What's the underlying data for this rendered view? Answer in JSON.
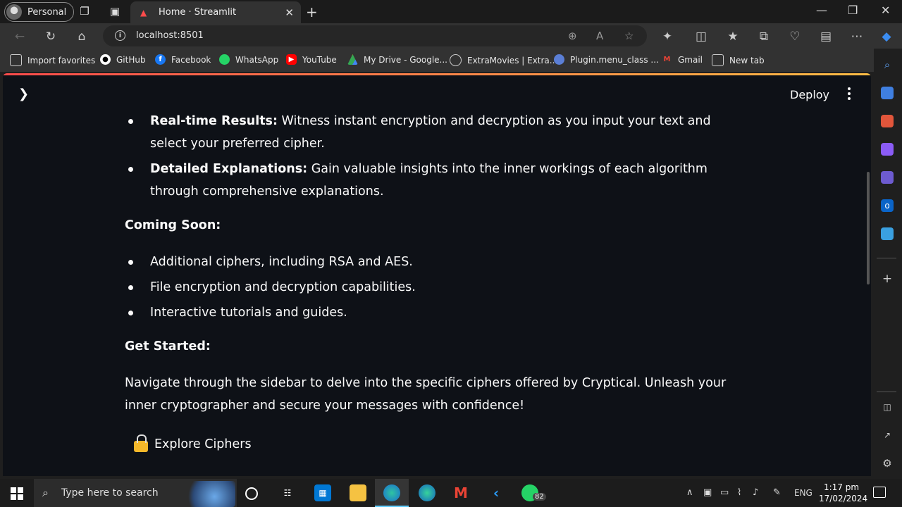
{
  "browser": {
    "profile_label": "Personal",
    "tab_title": "Home · Streamlit",
    "url": "localhost:8501",
    "bookmarks": [
      {
        "label": "Import favorites",
        "icon": "import-icon"
      },
      {
        "label": "GitHub",
        "icon": "github-icon"
      },
      {
        "label": "Facebook",
        "icon": "facebook-icon"
      },
      {
        "label": "WhatsApp",
        "icon": "whatsapp-icon"
      },
      {
        "label": "YouTube",
        "icon": "youtube-icon"
      },
      {
        "label": "My Drive - Google...",
        "icon": "google-drive-icon"
      },
      {
        "label": "ExtraMovies | Extra...",
        "icon": "movie-reel-icon"
      },
      {
        "label": "Plugin.menu_class ...",
        "icon": "plugin-icon"
      },
      {
        "label": "Gmail",
        "icon": "gmail-icon"
      },
      {
        "label": "New tab",
        "icon": "new-tab-icon"
      }
    ]
  },
  "app": {
    "deploy_label": "Deploy",
    "features": [
      {
        "title": "Real-time Results:",
        "text": " Witness instant encryption and decryption as you input your text and select your preferred cipher."
      },
      {
        "title": "Detailed Explanations:",
        "text": " Gain valuable insights into the inner workings of each algorithm through comprehensive explanations."
      }
    ],
    "coming_soon_heading": "Coming Soon:",
    "coming_soon_items": [
      "Additional ciphers, including RSA and AES.",
      "File encryption and decryption capabilities.",
      "Interactive tutorials and guides."
    ],
    "get_started_heading": "Get Started:",
    "get_started_text": "Navigate through the sidebar to delve into the specific ciphers offered by Cryptical. Unleash your inner cryptographer and secure your messages with confidence!",
    "explore_label": "Explore Ciphers"
  },
  "taskbar": {
    "search_placeholder": "Type here to search",
    "whatsapp_badge": "82",
    "language": "ENG",
    "time": "1:17 pm",
    "date": "17/02/2024"
  },
  "colors": {
    "page_bg": "#0e1117",
    "accent_red": "#ff4b4b",
    "accent_yellow": "#ffbd45"
  }
}
